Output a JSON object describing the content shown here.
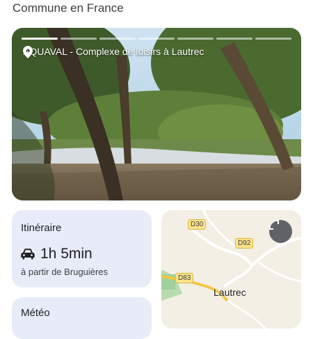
{
  "header": {
    "subtitle": "Commune en France"
  },
  "photo": {
    "caption": "AQUAVAL - Complexe de loisirs à Lautrec",
    "pin_icon": "location-pin-icon",
    "segments": 7,
    "active_segments": 1
  },
  "itinerary": {
    "title": "Itinéraire",
    "duration": "1h 5min",
    "from": "à partir de Bruguières",
    "icon": "car-icon"
  },
  "weather": {
    "title": "Météo"
  },
  "map": {
    "roads": [
      "D30",
      "D92",
      "D83"
    ],
    "town": "Lautrec",
    "expand_icon": "expand-icon"
  },
  "colors": {
    "card_bg": "#e8ecf9",
    "road_label_bg": "#fbe38a",
    "map_bg": "#f3efe4"
  }
}
